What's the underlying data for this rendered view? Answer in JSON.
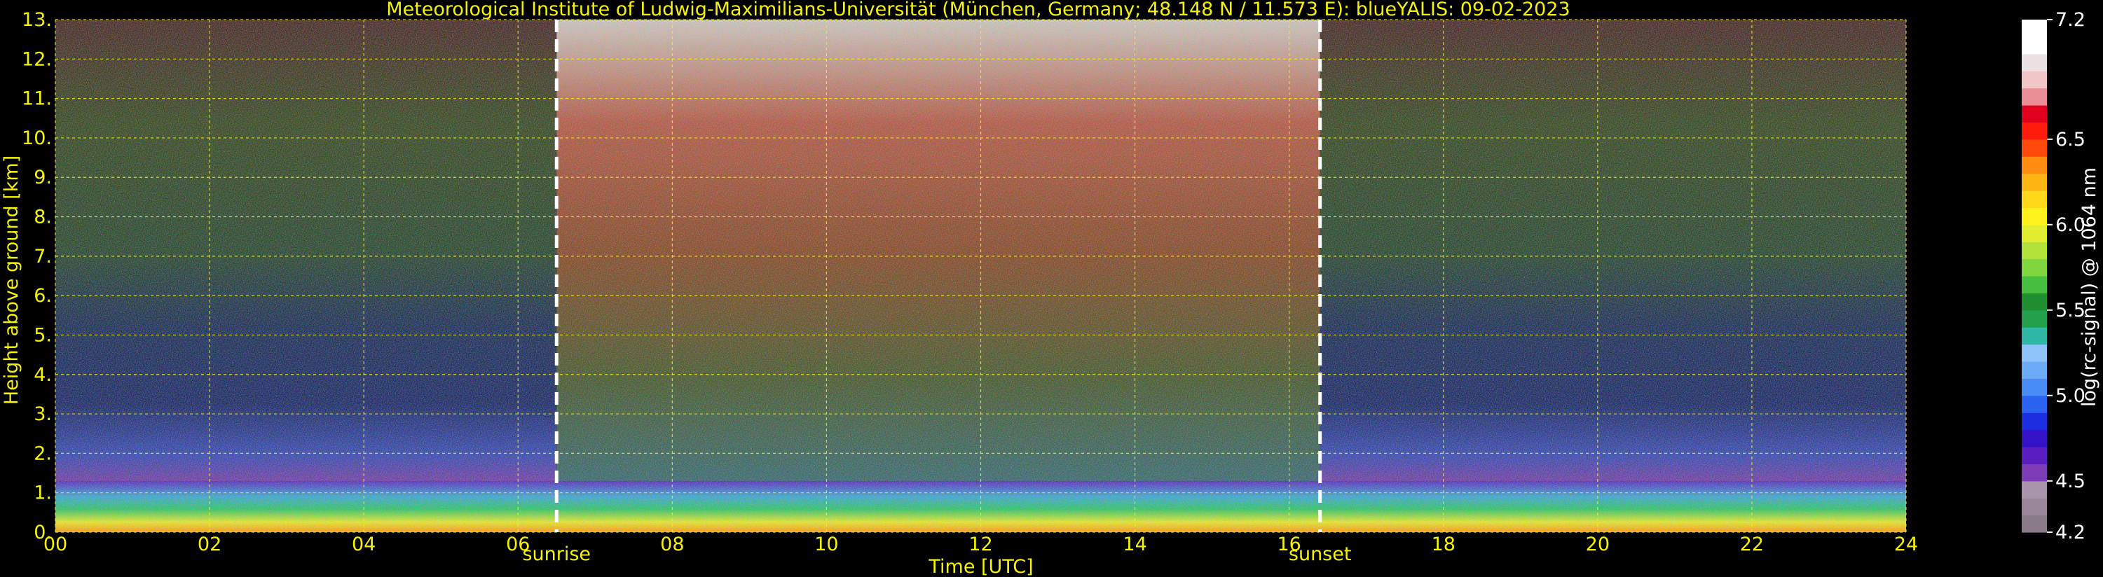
{
  "chart_data": {
    "type": "heatmap",
    "title": "Meteorological Institute of Ludwig-Maximilians-Universität (München, Germany; 48.148 N / 11.573 E):    blueYALIS: 09-02-2023",
    "xlabel": "Time [UTC]",
    "ylabel": "Height above ground [km]",
    "xlim": [
      0,
      24
    ],
    "ylim": [
      0,
      13
    ],
    "x_ticks": [
      "00",
      "02",
      "04",
      "06",
      "08",
      "10",
      "12",
      "14",
      "16",
      "18",
      "20",
      "22",
      "24"
    ],
    "y_ticks": [
      "0.",
      "1.",
      "2.",
      "3.",
      "4.",
      "5.",
      "6.",
      "7.",
      "8.",
      "9.",
      "10.",
      "11.",
      "12.",
      "13."
    ],
    "grid": true,
    "markers": [
      {
        "label": "sunrise",
        "x": 6.5
      },
      {
        "label": "sunset",
        "x": 16.4
      }
    ],
    "colorbar": {
      "label": "log(rc-signal) @ 1064 nm",
      "min": 4.2,
      "max": 7.2,
      "ticks": [
        "4.2",
        "4.5",
        "5.0",
        "5.5",
        "6.0",
        "6.5",
        "7.2"
      ],
      "colors": [
        "#8a7b88",
        "#9a889a",
        "#a895ab",
        "#7d3cb5",
        "#5a1ec0",
        "#3412c8",
        "#1b2fe0",
        "#2b63f0",
        "#4a8cf5",
        "#6aaaf7",
        "#8dc3f8",
        "#2fb8a6",
        "#23a04b",
        "#1f8e30",
        "#47c040",
        "#7fd63e",
        "#b0e23a",
        "#e3ed2f",
        "#fff21c",
        "#ffd81a",
        "#ffb514",
        "#ff8c10",
        "#ff4a0c",
        "#ff1c0a",
        "#e0001c",
        "#e98f95",
        "#f1c6c9",
        "#ece2e4",
        "#ffffff",
        "#ffffff"
      ]
    },
    "description_bands": [
      {
        "y_from": 0.0,
        "y_to": 0.3,
        "color": "#f3e633"
      },
      {
        "y_from": 0.3,
        "y_to": 0.8,
        "color": "#3fcf6a"
      },
      {
        "y_from": 0.8,
        "y_to": 1.3,
        "color": "#5a2cc0"
      },
      {
        "y_from": 1.3,
        "y_to": 3.0,
        "color": "#5a6fe6"
      },
      {
        "y_from": 3.0,
        "y_to": 6.0,
        "color": "#2f4a8a"
      },
      {
        "y_from": 6.0,
        "y_to": 13.0,
        "color": "#24551e"
      }
    ]
  }
}
